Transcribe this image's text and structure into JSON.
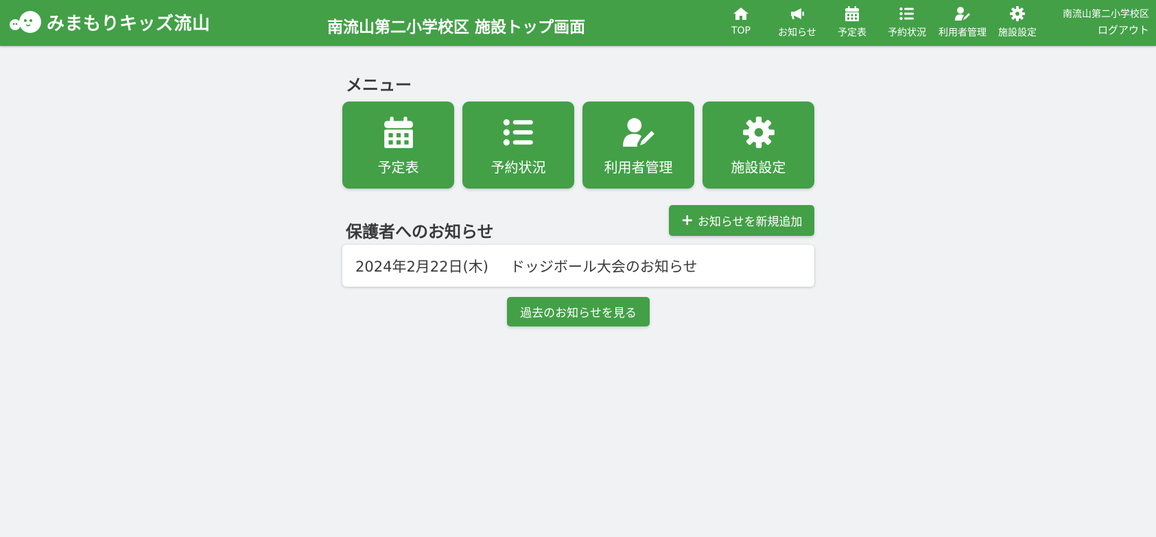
{
  "header": {
    "logo_text": "みまもりキッズ流山",
    "page_title": "南流山第二小学校区 施設トップ画面",
    "nav": [
      {
        "label": "TOP",
        "icon": "home-icon"
      },
      {
        "label": "お知らせ",
        "icon": "megaphone-icon"
      },
      {
        "label": "予定表",
        "icon": "calendar-icon"
      },
      {
        "label": "予約状況",
        "icon": "list-icon"
      },
      {
        "label": "利用者管理",
        "icon": "user-edit-icon"
      },
      {
        "label": "施設設定",
        "icon": "gear-icon"
      }
    ],
    "user_name": "南流山第二小学校区",
    "logout_label": "ログアウト"
  },
  "menu": {
    "title": "メニュー",
    "tiles": [
      {
        "label": "予定表",
        "icon": "calendar-icon"
      },
      {
        "label": "予約状況",
        "icon": "list-icon"
      },
      {
        "label": "利用者管理",
        "icon": "user-edit-icon"
      },
      {
        "label": "施設設定",
        "icon": "gear-icon"
      }
    ]
  },
  "notices": {
    "title": "保護者へのお知らせ",
    "add_button_label": "お知らせを新規追加",
    "items": [
      {
        "date": "2024年2月22日(木)",
        "title": "ドッジボール大会のお知らせ"
      }
    ],
    "past_button_label": "過去のお知らせを見る"
  },
  "colors": {
    "primary": "#43a047",
    "background": "#f0f2f4",
    "text": "#3a3a3a"
  }
}
